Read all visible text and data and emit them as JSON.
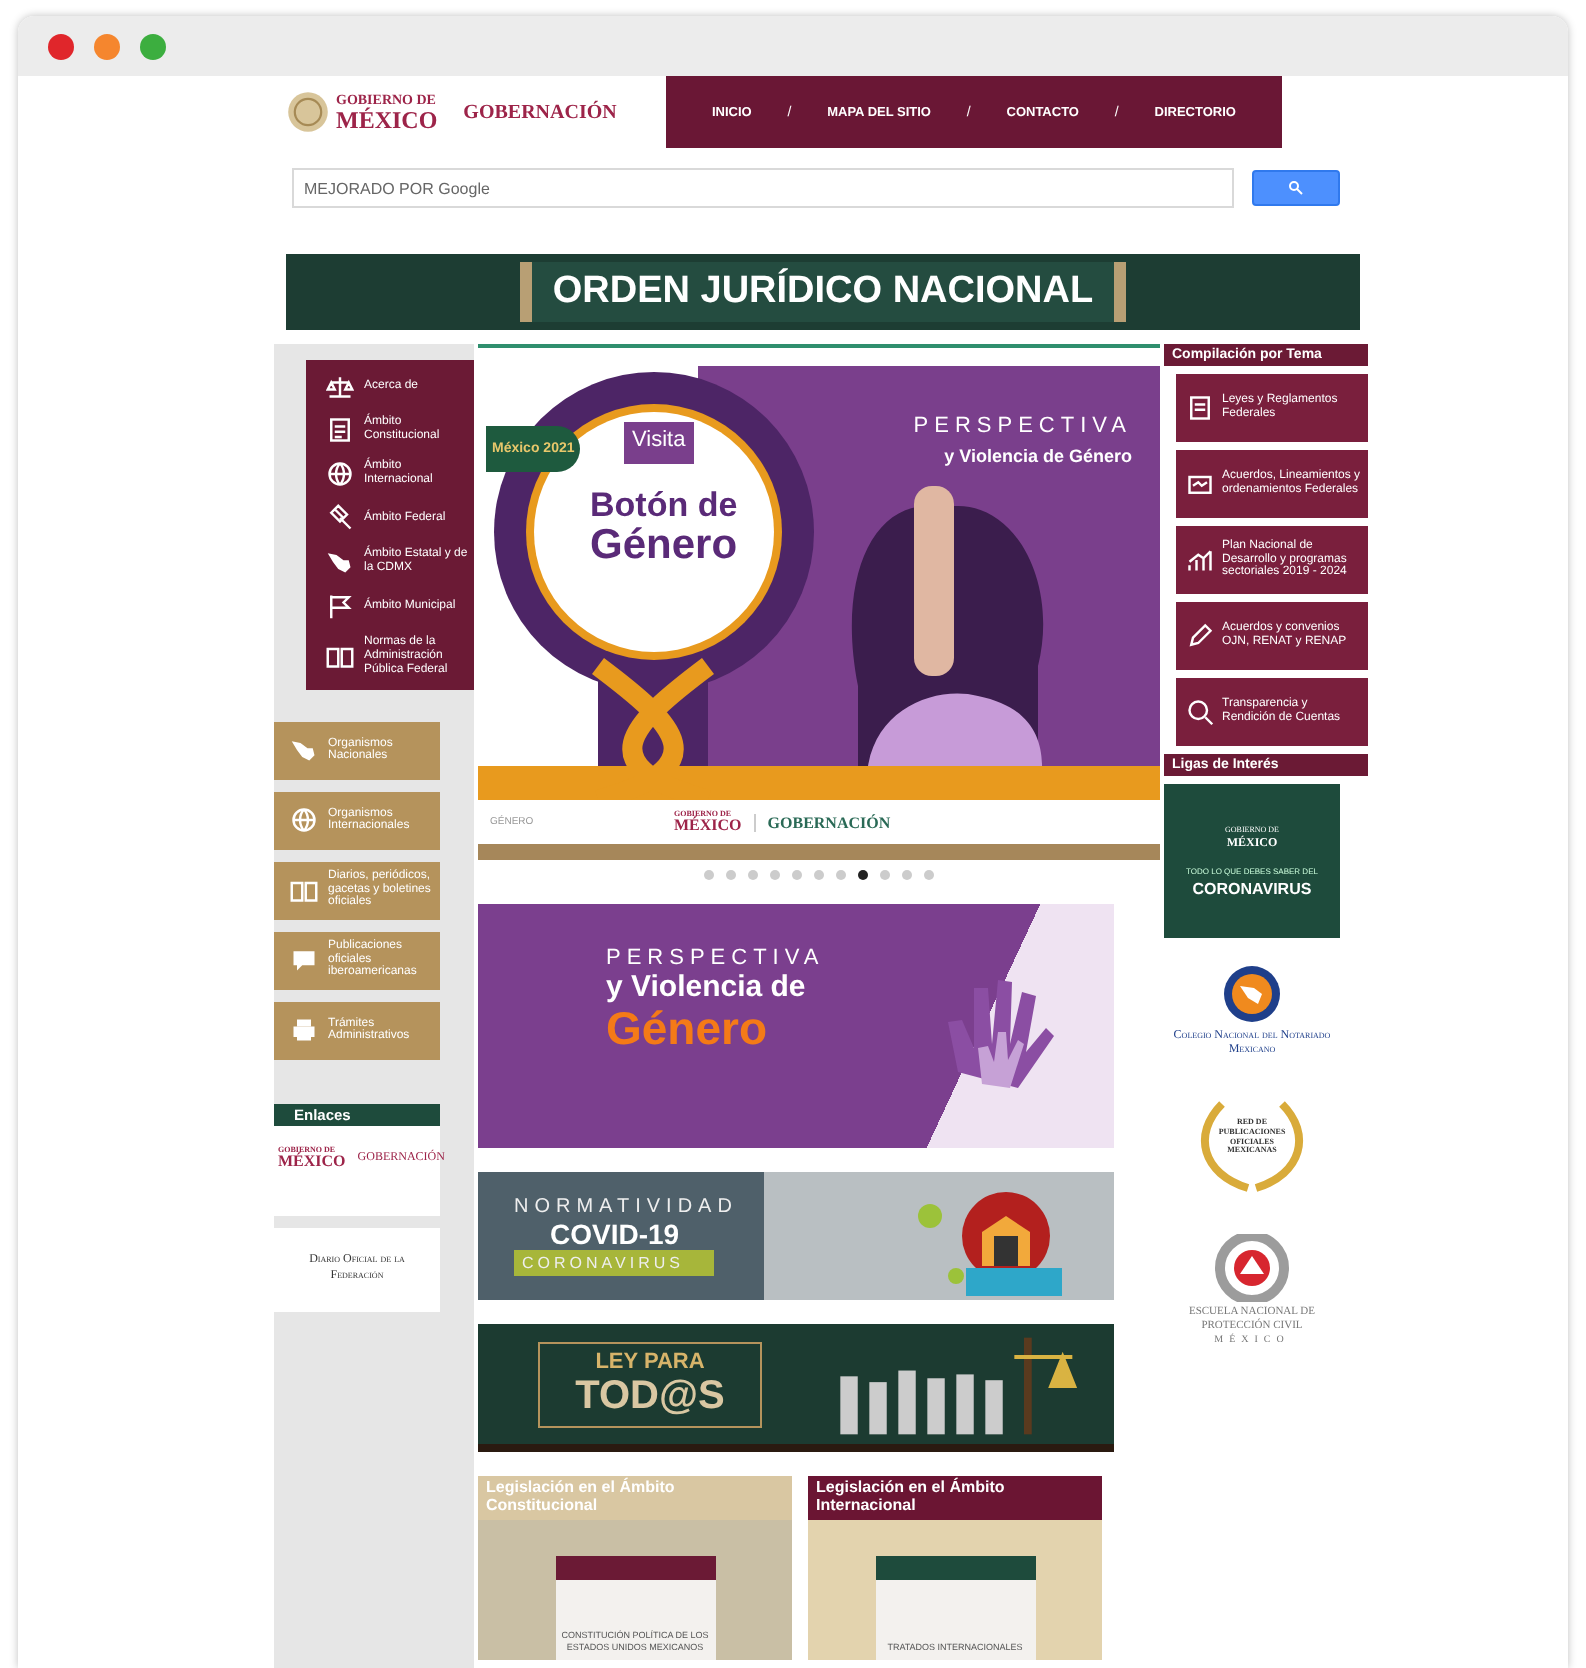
{
  "window_controls": [
    {
      "color": "#e0262b"
    },
    {
      "color": "#f5862e"
    },
    {
      "color": "#3cae3f"
    }
  ],
  "header": {
    "logo_top": "GOBIERNO DE",
    "logo_bottom": "MÉXICO",
    "agency": "GOBERNACIÓN",
    "nav": [
      {
        "label": "INICIO"
      },
      {
        "label": "MAPA DEL SITIO"
      },
      {
        "label": "CONTACTO"
      },
      {
        "label": "DIRECTORIO"
      }
    ],
    "separator": "/"
  },
  "search": {
    "placeholder": "MEJORADO POR Google"
  },
  "title_banner": "ORDEN JURÍDICO NACIONAL",
  "left_menu": [
    "Acerca de",
    "Ámbito Constitucional",
    "Ámbito Internacional",
    "Ámbito Federal",
    "Ámbito Estatal y de la CDMX",
    "Ámbito Municipal",
    "Normas de la Administración Pública Federal"
  ],
  "left_buttons": [
    "Organismos Nacionales",
    "Organismos Internacionales",
    "Diarios, periódicos, gacetas y boletines oficiales",
    "Publicaciones oficiales iberoamericanas",
    "Trámites Administrativos"
  ],
  "links": {
    "title": "Enlaces",
    "logo_top": "GOBIERNO DE",
    "logo_bottom": "MÉXICO",
    "agency": "GOBERNACIÓN",
    "dof": "Diario Oficial de la Federación"
  },
  "slider": {
    "badge": "México 2021",
    "tag": "Visita",
    "headline_1": "Botón de",
    "headline_2": "Género",
    "kicker": "PERSPECTIVA",
    "subtitle": "y Violencia de Género",
    "footer_label": "GÉNERO",
    "footer_logo_top": "GOBIERNO DE",
    "footer_logo_bottom": "MÉXICO",
    "footer_agency": "GOBERNACIÓN",
    "dots": [
      {
        "selected": false
      },
      {
        "selected": false
      },
      {
        "selected": false
      },
      {
        "selected": false
      },
      {
        "selected": false
      },
      {
        "selected": false
      },
      {
        "selected": false
      },
      {
        "selected": true
      },
      {
        "selected": false
      },
      {
        "selected": false
      },
      {
        "selected": false
      }
    ]
  },
  "banners": [
    {
      "kind": "gender",
      "line_1": "PERSPECTIVA",
      "line_2": "y Violencia de",
      "line_3": "Género"
    },
    {
      "kind": "covid",
      "line_1": "NORMATIVIDAD",
      "line_2": "COVID-19",
      "line_3": "CORONAVIRUS"
    },
    {
      "kind": "law",
      "line_1": "LEY PARA",
      "line_2": "TOD@S"
    }
  ],
  "cards": [
    {
      "title": "Legislación en el Ámbito Constitucional",
      "caption": "CONSTITUCIÓN POLÍTICA DE LOS ESTADOS UNIDOS MEXICANOS",
      "color": "#d9c7a2"
    },
    {
      "title": "Legislación en el Ámbito Internacional",
      "caption": "TRATADOS INTERNACIONALES",
      "color": "#6b1533"
    }
  ],
  "compilation": {
    "title": "Compilación por Tema",
    "items": [
      "Leyes y Reglamentos Federales",
      "Acuerdos, Lineamientos y ordenamientos Federales",
      "Plan Nacional de Desarrollo y programas sectoriales 2019 - 2024",
      "Acuerdos y convenios OJN, RENAT y RENAP",
      "Transparencia y Rendición de Cuentas"
    ]
  },
  "interest": {
    "title": "Ligas de Interés",
    "items": [
      {
        "kind": "covid",
        "line_1": "GOBIERNO DE",
        "line_2": "MÉXICO",
        "line_3": "TODO LO QUE DEBES SABER DEL",
        "line_4": "CORONAVIRUS"
      },
      {
        "kind": "notary",
        "line_1": "Colegio Nacional del Notariado Mexicano"
      },
      {
        "kind": "publications",
        "line_1": "RED DE PUBLICACIONES OFICIALES MEXICANAS"
      },
      {
        "kind": "civil",
        "line_1": "ESCUELA NACIONAL DE PROTECCIÓN CIVIL",
        "line_2": "MÉXICO"
      }
    ]
  }
}
